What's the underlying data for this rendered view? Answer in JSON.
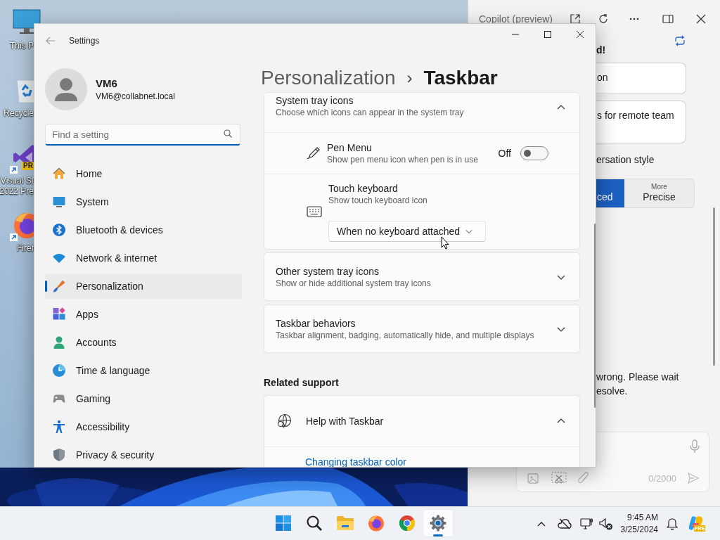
{
  "desktop": {
    "icons": [
      {
        "kind": "monitor",
        "lines": [
          "This P"
        ],
        "shortcut": false
      },
      {
        "kind": "recycle",
        "lines": [
          "Recycle"
        ],
        "shortcut": false
      },
      {
        "kind": "studio",
        "lines": [
          "Visual St",
          "2022 Pre"
        ],
        "shortcut": true,
        "badge": "PR"
      },
      {
        "kind": "firefox",
        "lines": [
          "Firef"
        ],
        "shortcut": true
      }
    ]
  },
  "copilot": {
    "title": "Copilot (preview)",
    "greeting": "d!",
    "suggestions": [
      "on",
      "s for remote team"
    ],
    "style_label": "ersation style",
    "styles": [
      {
        "label": "ced",
        "selected": true
      },
      {
        "caption": "More",
        "label": "Precise",
        "selected": false
      }
    ],
    "message": [
      "wrong. Please wait",
      "esolve."
    ],
    "counter": "0/2000"
  },
  "settings": {
    "title": "Settings",
    "user": {
      "name": "VM6",
      "email": "VM6@collabnet.local"
    },
    "search": {
      "placeholder": "Find a setting"
    },
    "nav": [
      {
        "kind": "home",
        "label": "Home",
        "selected": false
      },
      {
        "kind": "system",
        "label": "System",
        "selected": false
      },
      {
        "kind": "bluetooth",
        "label": "Bluetooth & devices",
        "selected": false
      },
      {
        "kind": "network",
        "label": "Network & internet",
        "selected": false
      },
      {
        "kind": "brush",
        "label": "Personalization",
        "selected": true
      },
      {
        "kind": "apps",
        "label": "Apps",
        "selected": false
      },
      {
        "kind": "accounts",
        "label": "Accounts",
        "selected": false
      },
      {
        "kind": "time",
        "label": "Time & language",
        "selected": false
      },
      {
        "kind": "gaming",
        "label": "Gaming",
        "selected": false
      },
      {
        "kind": "accessibility",
        "label": "Accessibility",
        "selected": false
      },
      {
        "kind": "privacy",
        "label": "Privacy & security",
        "selected": false
      }
    ],
    "breadcrumb": {
      "parent": "Personalization",
      "separator": "›",
      "current": "Taskbar"
    },
    "cards": [
      {
        "title": "System tray icons",
        "subtitle": "Choose which icons can appear in the system tray",
        "expanded": true,
        "rows": [
          {
            "kind": "toggle",
            "title": "Pen Menu",
            "subtitle": "Show pen menu icon when pen is in use",
            "state": "Off",
            "on": false
          },
          {
            "kind": "dropdown",
            "title": "Touch keyboard",
            "subtitle": "Show touch keyboard icon",
            "value": "When no keyboard attached"
          }
        ]
      },
      {
        "title": "Other system tray icons",
        "subtitle": "Show or hide additional system tray icons",
        "expanded": false
      },
      {
        "title": "Taskbar behaviors",
        "subtitle": "Taskbar alignment, badging, automatically hide, and multiple displays",
        "expanded": false
      }
    ],
    "related": {
      "heading": "Related support",
      "cards": [
        {
          "title": "Help with Taskbar",
          "expanded": true,
          "links": [
            "Changing taskbar color"
          ]
        }
      ]
    }
  },
  "taskbar": {
    "apps": [
      {
        "kind": "start",
        "selected": false
      },
      {
        "kind": "search",
        "selected": false
      },
      {
        "kind": "explorer",
        "selected": false
      },
      {
        "kind": "firefox",
        "selected": false
      },
      {
        "kind": "chrome",
        "selected": false
      },
      {
        "kind": "settings",
        "selected": true
      }
    ],
    "time": "9:45 AM",
    "date": "3/25/2024",
    "copilot_badge": "PRE"
  }
}
